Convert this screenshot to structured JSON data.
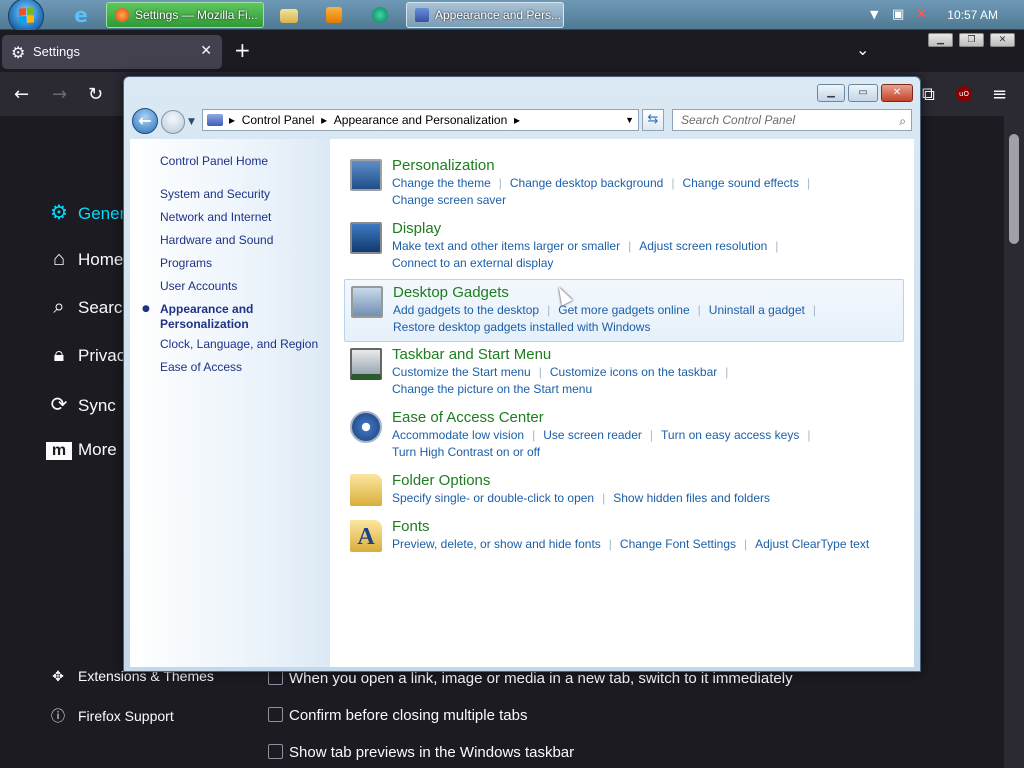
{
  "taskbar": {
    "start_button": "start-orb",
    "pinned": [
      "ie-icon",
      "explorer-icon",
      "media-player-icon",
      "app-icon"
    ],
    "tasks": [
      {
        "label": "Settings — Mozilla Fi...",
        "icon": "firefox-icon",
        "active": true
      },
      {
        "label": "Appearance and Pers...",
        "icon": "control-panel-icon",
        "active": true
      }
    ],
    "clock": "10:57 AM"
  },
  "firefox": {
    "tab_label": "Settings",
    "sidebar": [
      {
        "label": "Gener",
        "icon": "gear-icon",
        "active": true
      },
      {
        "label": "Home",
        "icon": "home-icon"
      },
      {
        "label": "Search",
        "icon": "search-icon"
      },
      {
        "label": "Privacy",
        "icon": "lock-icon"
      },
      {
        "label": "Sync",
        "icon": "sync-icon"
      },
      {
        "label": "More",
        "icon": "mozilla-icon"
      }
    ],
    "bottom_links": [
      {
        "label": "Extensions & Themes",
        "icon": "puzzle-icon"
      },
      {
        "label": "Firefox Support",
        "icon": "help-icon"
      }
    ],
    "checkboxes": [
      "When you open a link, image or media in a new tab, switch to it immediately",
      "Confirm before closing multiple tabs",
      "Show tab previews in the Windows taskbar"
    ]
  },
  "control_panel": {
    "breadcrumb": [
      "Control Panel",
      "Appearance and Personalization"
    ],
    "search_placeholder": "Search Control Panel",
    "left_nav": [
      "Control Panel Home",
      "System and Security",
      "Network and Internet",
      "Hardware and Sound",
      "Programs",
      "User Accounts",
      "Appearance and Personalization",
      "Clock, Language, and Region",
      "Ease of Access"
    ],
    "current_nav": "Appearance and Personalization",
    "categories": [
      {
        "title": "Personalization",
        "icon": "personalization-icon",
        "links": [
          "Change the theme",
          "Change desktop background",
          "Change sound effects",
          "Change screen saver"
        ]
      },
      {
        "title": "Display",
        "icon": "display-icon",
        "links": [
          "Make text and other items larger or smaller",
          "Adjust screen resolution",
          "Connect to an external display"
        ]
      },
      {
        "title": "Desktop Gadgets",
        "icon": "gadgets-icon",
        "links": [
          "Add gadgets to the desktop",
          "Get more gadgets online",
          "Uninstall a gadget",
          "Restore desktop gadgets installed with Windows"
        ]
      },
      {
        "title": "Taskbar and Start Menu",
        "icon": "taskbar-icon",
        "links": [
          "Customize the Start menu",
          "Customize icons on the taskbar",
          "Change the picture on the Start menu"
        ]
      },
      {
        "title": "Ease of Access Center",
        "icon": "ease-of-access-icon",
        "links": [
          "Accommodate low vision",
          "Use screen reader",
          "Turn on easy access keys",
          "Turn High Contrast on or off"
        ]
      },
      {
        "title": "Folder Options",
        "icon": "folder-options-icon",
        "links": [
          "Specify single- or double-click to open",
          "Show hidden files and folders"
        ]
      },
      {
        "title": "Fonts",
        "icon": "fonts-icon",
        "links": [
          "Preview, delete, or show and hide fonts",
          "Change Font Settings",
          "Adjust ClearType text"
        ]
      }
    ]
  },
  "colors": {
    "category_title": "#1e7d1e",
    "link": "#1c5fa8",
    "nav_link": "#1e3287",
    "firefox_accent": "#00ddff"
  }
}
